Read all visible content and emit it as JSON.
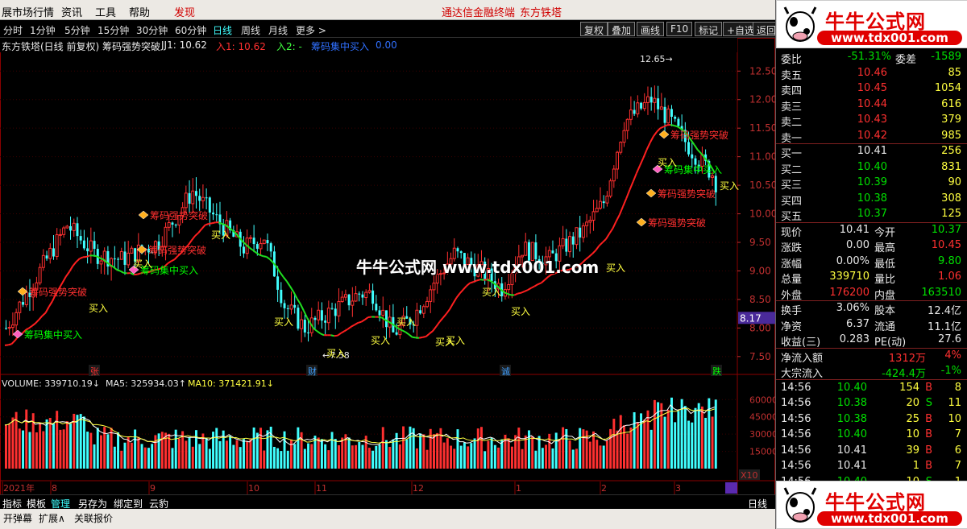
{
  "menu": {
    "items": [
      "展市场行情",
      "资讯",
      "工具",
      "帮助",
      "发现"
    ],
    "links": [
      "通达信金融终端",
      "东方铁塔"
    ]
  },
  "periods": [
    "分时",
    "1分钟",
    "5分钟",
    "15分钟",
    "30分钟",
    "60分钟",
    "日线",
    "周线",
    "月线",
    "更多 >"
  ],
  "toolbar": [
    "复权",
    "叠加",
    "画线",
    "F10",
    "标记",
    "+自选",
    "返回"
  ],
  "info": {
    "title": "东方铁塔(日线 前复权) 筹码强势突破",
    "jj1_label": "JJ1: 10.62",
    "ru1_label": "入1: 10.62",
    "ru2_label": "入2: -",
    "ind_label": "筹码集中买入",
    "ind_val": "0.00"
  },
  "chart_data": {
    "type": "candlestick",
    "title": "东方铁塔(日线 前复权)",
    "y_ticks": [
      "12.50",
      "12.00",
      "11.50",
      "11.00",
      "10.50",
      "10.00",
      "9.50",
      "9.00",
      "8.50",
      "8.00",
      "7.50"
    ],
    "ylim": [
      7.3,
      12.8
    ],
    "high_label": "12.65",
    "low_label": "7.58",
    "price_cursor": "8.17",
    "ma_label": "",
    "x_labels": [
      "2021年",
      "8",
      "9",
      "10",
      "11",
      "12",
      "1",
      "2",
      "3"
    ],
    "events": [
      "张",
      "财",
      "诚",
      "跌"
    ],
    "signals": {
      "buy": "买入",
      "strong": "筹码强势突破",
      "concentrate": "筹码集中买入"
    },
    "volume": {
      "label": "VOLUME: 339710.19",
      "ma5": "MA5: 325934.03",
      "ma10": "MA10: 371421.91",
      "y_ticks": [
        "60000",
        "45000",
        "30000",
        "15000"
      ],
      "unit": "X10"
    }
  },
  "side": {
    "quotes_sell": [
      [
        "卖五",
        "10.46",
        "85"
      ],
      [
        "卖四",
        "10.45",
        "1054"
      ],
      [
        "卖三",
        "10.44",
        "616"
      ],
      [
        "卖二",
        "10.43",
        "379"
      ],
      [
        "卖一",
        "10.42",
        "985"
      ]
    ],
    "quotes_buy": [
      [
        "买一",
        "10.41",
        "256"
      ],
      [
        "买二",
        "10.40",
        "831"
      ],
      [
        "买三",
        "10.39",
        "90"
      ],
      [
        "买四",
        "10.38",
        "308"
      ],
      [
        "买五",
        "10.37",
        "125"
      ]
    ],
    "top_partial": [
      "委比",
      "-51.31%",
      "委差",
      "-1589"
    ],
    "stats": [
      [
        "现价",
        "10.41",
        "今开",
        "10.37"
      ],
      [
        "涨跌",
        "0.00",
        "最高",
        "10.45"
      ],
      [
        "涨幅",
        "0.00%",
        "最低",
        "9.80"
      ],
      [
        "总量",
        "339710",
        "量比",
        "1.06"
      ],
      [
        "外盘",
        "176200",
        "内盘",
        "163510"
      ]
    ],
    "stats2": [
      [
        "换手",
        "3.06%",
        "股本",
        "12.4亿"
      ],
      [
        "净资",
        "6.37",
        "流通",
        "11.1亿"
      ],
      [
        "收益(三)",
        "0.283",
        "PE(动)",
        "27.6"
      ]
    ],
    "flow": [
      [
        "净流入额",
        "1312万",
        "4%"
      ],
      [
        "大宗流入",
        "-424.4万",
        "-1%"
      ]
    ],
    "ticks": [
      [
        "14:56",
        "10.40",
        "154",
        "B",
        "8"
      ],
      [
        "14:56",
        "10.38",
        "20",
        "S",
        "11"
      ],
      [
        "14:56",
        "10.38",
        "25",
        "B",
        "10"
      ],
      [
        "14:56",
        "10.40",
        "10",
        "B",
        "7"
      ],
      [
        "14:56",
        "10.41",
        "39",
        "B",
        "6"
      ],
      [
        "14:56",
        "10.41",
        "1",
        "B",
        "7"
      ],
      [
        "14:56",
        "10.40",
        "10",
        "S",
        "1"
      ]
    ]
  },
  "logo": {
    "name": "牛牛公式网",
    "url": "www.tdx001.com"
  },
  "bottom": {
    "tabs1": [
      "指标",
      "模板",
      "管理",
      "另存为",
      "绑定到",
      "云豹"
    ],
    "tabs2": [
      "开弹幕",
      "扩展∧",
      "关联报价"
    ],
    "period_tag": "日线"
  },
  "watermark": "牛牛公式网 www.tdx001.com",
  "colors": {
    "up": "#ff3030",
    "down": "#40ffff",
    "ma_up": "#ff2020",
    "ma_down": "#20e020"
  }
}
